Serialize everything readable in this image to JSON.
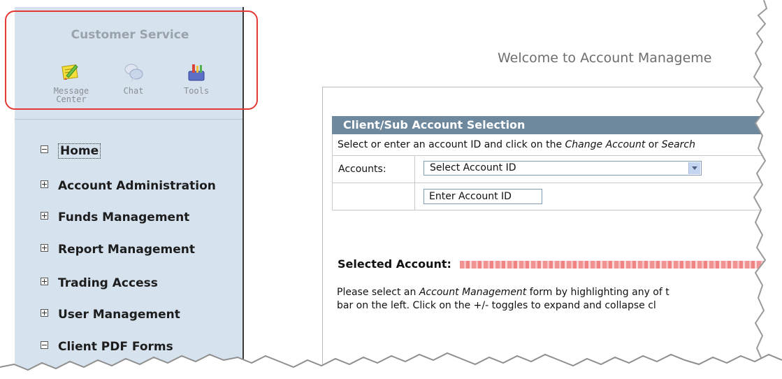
{
  "sidebar": {
    "title": "Customer Service",
    "tools": [
      {
        "label_line1": "Message",
        "label_line2": "Center",
        "icon": "message-center-icon"
      },
      {
        "label_line1": "Chat",
        "label_line2": "",
        "icon": "chat-icon"
      },
      {
        "label_line1": "Tools",
        "label_line2": "",
        "icon": "tools-icon"
      }
    ],
    "nav": [
      {
        "label": "Home",
        "toggle": "minus"
      },
      {
        "label": "Account Administration",
        "toggle": "plus"
      },
      {
        "label": "Funds Management",
        "toggle": "plus"
      },
      {
        "label": "Report Management",
        "toggle": "plus"
      },
      {
        "label": "Trading Access",
        "toggle": "plus"
      },
      {
        "label": "User Management",
        "toggle": "plus"
      },
      {
        "label": "Client PDF Forms",
        "toggle": "minus"
      }
    ]
  },
  "main": {
    "welcome": "Welcome to Account Manageme",
    "panel_title": "Client/Sub Account Selection",
    "instruction_prefix": "Select or enter an account ID and click on the ",
    "instruction_em1": "Change Account",
    "instruction_mid": " or ",
    "instruction_em2": "Search",
    "accounts_label": "Accounts:",
    "account_select_value": "Select Account ID",
    "account_input_value": "Enter Account ID",
    "selected_account_label": "Selected Account:",
    "body_line1_prefix": "Please select an ",
    "body_line1_em": "Account Management",
    "body_line1_suffix": " form by highlighting any of t",
    "body_line2": "bar on the left. Click on the +/- toggles to expand and collapse cl"
  },
  "colors": {
    "sidebar_bg": "#d6e2ee",
    "panel_header_bg": "#6e889e",
    "highlight_border": "#e53935"
  }
}
